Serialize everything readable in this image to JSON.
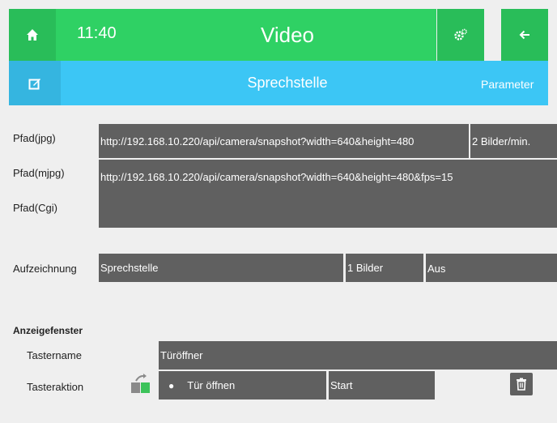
{
  "header": {
    "time": "11:40",
    "title": "Video",
    "icons": {
      "home": "home-icon",
      "settings": "settings-gear-icon",
      "back": "arrow-left-icon"
    }
  },
  "subheader": {
    "title": "Sprechstelle",
    "parameter_label": "Parameter",
    "edit_icon": "edit-icon"
  },
  "paths": [
    {
      "label": "Pfad(jpg)",
      "value": "http://192.168.10.220/api/camera/snapshot?width=640&height=480",
      "rate": "2 Bilder/min."
    },
    {
      "label": "Pfad(mjpg)",
      "value": "http://192.168.10.220/api/camera/snapshot?width=640&height=480&fps=15"
    },
    {
      "label": "Pfad(Cgi)",
      "value": ""
    }
  ],
  "recording": {
    "label": "Aufzeichnung",
    "name": "Sprechstelle",
    "count": "1 Bilder",
    "state": "Aus"
  },
  "display_window": {
    "section_title": "Anzeigefenster",
    "button_name_label": "Tastername",
    "button_name_value": "Türöffner",
    "button_action_label": "Tasteraktion",
    "action_value": "Tür öffnen",
    "action_trigger": "Start",
    "icons": {
      "door": "door-open-icon",
      "delete": "trash-icon"
    },
    "colors": {
      "door_icon_accent": "#3cc35a"
    }
  },
  "colors": {
    "header_green": "#2fd164",
    "subheader_blue": "#3cc6f5",
    "field_gray": "#606060",
    "background": "#efefef"
  }
}
